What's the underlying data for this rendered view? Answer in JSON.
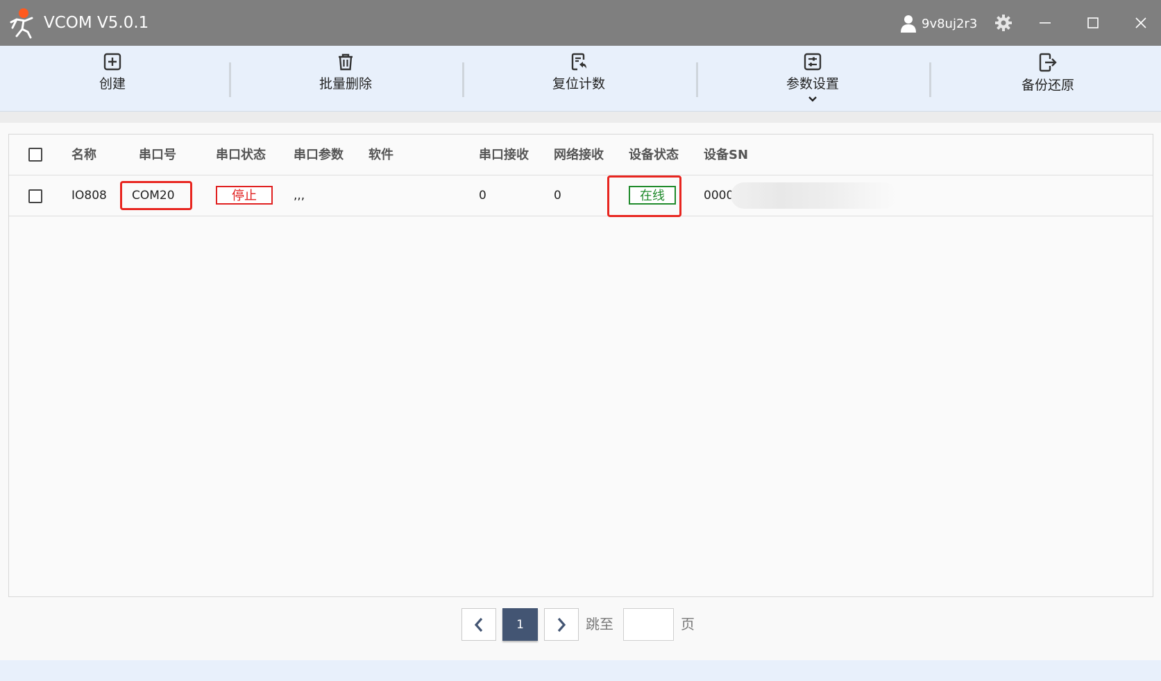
{
  "window": {
    "title": "VCOM V5.0.1",
    "username": "9v8uj2r3",
    "icons": {
      "logo": "person-logo-icon",
      "user": "user-icon",
      "settings": "gear-icon",
      "minimize": "minimize-icon",
      "maximize": "maximize-icon",
      "close": "close-icon"
    }
  },
  "toolbar": {
    "items": [
      {
        "key": "create",
        "label": "创建",
        "icon": "plus-square-icon"
      },
      {
        "key": "batch-delete",
        "label": "批量删除",
        "icon": "trash-icon"
      },
      {
        "key": "reset-count",
        "label": "复位计数",
        "icon": "reset-document-icon"
      },
      {
        "key": "param-settings",
        "label": "参数设置",
        "icon": "sliders-icon",
        "has_dropdown": true
      },
      {
        "key": "backup-restore",
        "label": "备份还原",
        "icon": "export-icon"
      }
    ]
  },
  "table": {
    "columns": [
      {
        "key": "name",
        "label": "名称"
      },
      {
        "key": "com_port",
        "label": "串口号"
      },
      {
        "key": "com_status",
        "label": "串口状态"
      },
      {
        "key": "com_params",
        "label": "串口参数"
      },
      {
        "key": "software",
        "label": "软件"
      },
      {
        "key": "com_rx",
        "label": "串口接收"
      },
      {
        "key": "net_rx",
        "label": "网络接收"
      },
      {
        "key": "device_status",
        "label": "设备状态"
      },
      {
        "key": "device_sn",
        "label": "设备SN"
      }
    ],
    "rows": [
      {
        "checked": false,
        "name": "IO808",
        "com_port": "COM20",
        "com_status": "停止",
        "com_params": ",,,",
        "software": "",
        "com_rx": "0",
        "net_rx": "0",
        "device_status": "在线",
        "device_sn": "0000"
      }
    ]
  },
  "colors": {
    "titlebar": "#7f7f7f",
    "toolbar": "#e8f0fb",
    "stopped": "#e02020",
    "online": "#1f8a2b",
    "annotation": "#e8251f",
    "pager_active": "#435573"
  },
  "pager": {
    "current_page": "1",
    "jump_label": "跳至",
    "page_suffix": "页",
    "jump_value": ""
  }
}
